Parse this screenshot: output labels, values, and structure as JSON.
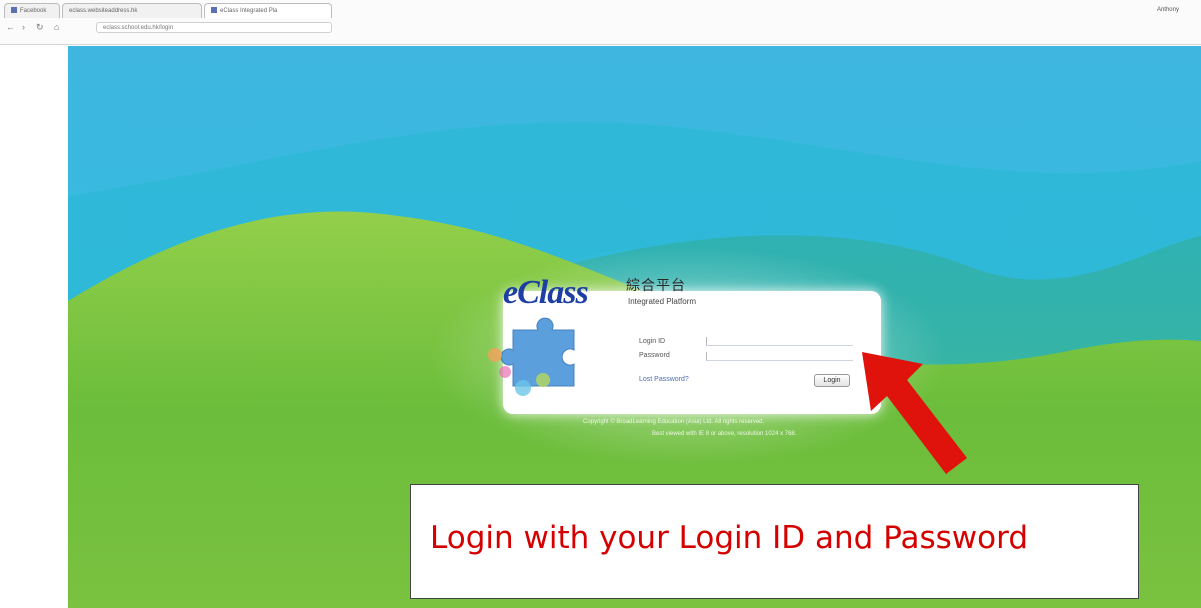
{
  "browser": {
    "tabs": [
      {
        "label": "Facebook"
      },
      {
        "label": "eclass.websiteaddress.hk"
      },
      {
        "label": "eClass Integrated Pla"
      }
    ],
    "user_name": "Anthony",
    "omnibox_text": "eclass.school.edu.hk/login",
    "nav": {
      "back": "←",
      "forward": "›",
      "reload": "↻",
      "home": "⌂"
    }
  },
  "login_panel": {
    "logo": "eClass",
    "title_zh": "綜合平台",
    "subtitle": "Integrated Platform",
    "login_id_label": "Login ID",
    "password_label": "Password",
    "forgot_link": "Lost Password?",
    "login_button": "Login",
    "footer_line_1": "Copyright © BroadLearning Education (Asia) Ltd. All rights reserved.",
    "footer_line_2": "Best viewed with IE 8 or above, resolution 1024 x 768."
  },
  "annotation": {
    "instruction": "Login with your Login ID and Password",
    "arrow_color": "#e0120c"
  },
  "colors": {
    "sky": "#33b5e5",
    "hill_front": "#6cbf3c",
    "hill_back": "#3fae9a",
    "logo_blue": "#1d3fa3",
    "callout_text": "#d50000"
  }
}
